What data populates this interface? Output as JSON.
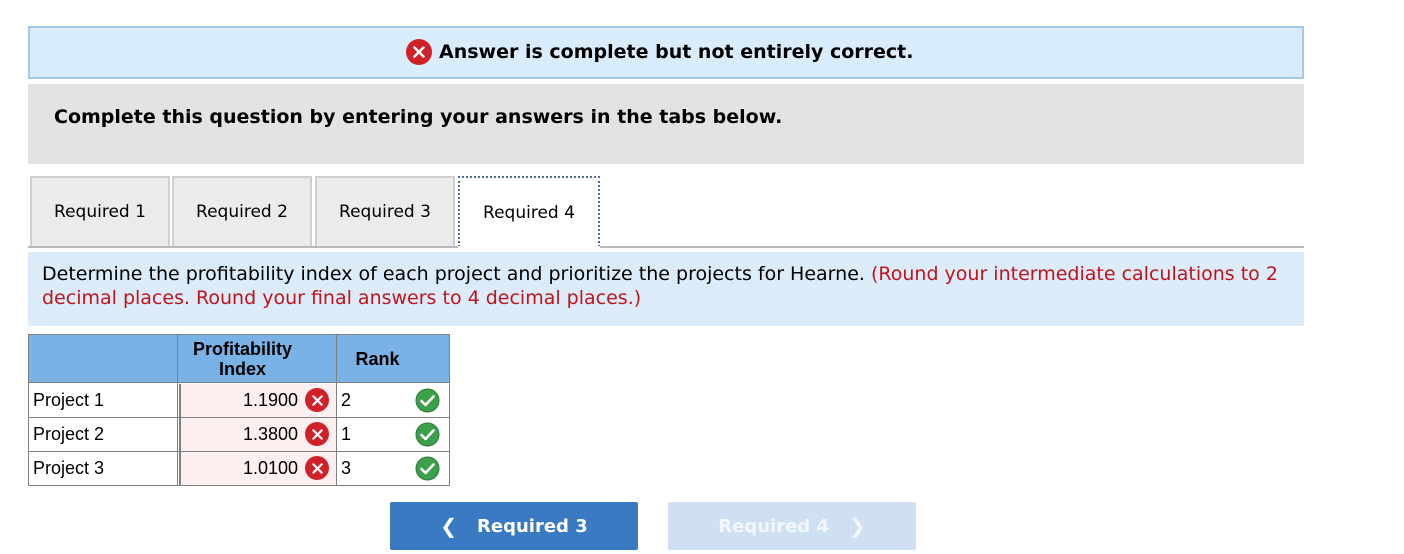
{
  "banner": {
    "text": "Answer is complete but not entirely correct.",
    "icon": "x-circle-icon"
  },
  "instruction": "Complete this question by entering your answers in the tabs below.",
  "tabs": [
    {
      "label": "Required 1",
      "active": false
    },
    {
      "label": "Required 2",
      "active": false
    },
    {
      "label": "Required 3",
      "active": false
    },
    {
      "label": "Required 4",
      "active": true
    }
  ],
  "prompt": {
    "main": "Determine the profitability index of each project and prioritize the projects for Hearne.",
    "note": "(Round your intermediate calculations to 2 decimal places. Round your final answers to 4 decimal places.)"
  },
  "table": {
    "headers": [
      "",
      "Profitability Index",
      "Rank"
    ],
    "rows": [
      {
        "label": "Project 1",
        "pi": "1.1900",
        "pi_status": "incorrect",
        "rank": "2",
        "rank_status": "correct"
      },
      {
        "label": "Project 2",
        "pi": "1.3800",
        "pi_status": "incorrect",
        "rank": "1",
        "rank_status": "correct"
      },
      {
        "label": "Project 3",
        "pi": "1.0100",
        "pi_status": "incorrect",
        "rank": "3",
        "rank_status": "correct"
      }
    ]
  },
  "nav": {
    "prev_label": "Required 3",
    "next_label": "Required 4"
  },
  "colors": {
    "incorrect": "#d0202a",
    "correct": "#3aa04a",
    "header_blue": "#7ab2e6",
    "button_blue": "#3a7ac2"
  }
}
